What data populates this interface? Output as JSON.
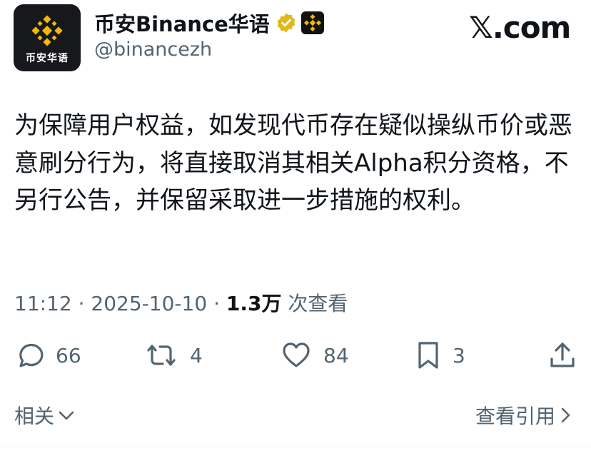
{
  "author": {
    "avatar_label": "币安华语",
    "display_name": "币安Binance华语",
    "handle": "@binancezh",
    "verified_icon": "verified-gold-badge-icon",
    "affiliate_icon": "binance-affiliate-badge-icon"
  },
  "site_logo": "𝕏.com",
  "tweet": {
    "text": "为保障用户权益，如发现代币存在疑似操纵币价或恶意刷分行为，将直接取消其相关Alpha积分资格，不另行公告，并保留采取进一步措施的权利。",
    "time": "11:12",
    "separator": "·",
    "date": "2025-10-10",
    "views": "1.3万",
    "views_label": "次查看"
  },
  "actions": {
    "replies": "66",
    "retweets": "4",
    "likes": "84",
    "bookmarks": "3"
  },
  "footer": {
    "related": "相关",
    "view_quotes": "查看引用"
  },
  "colors": {
    "binance_yellow": "#F0B90B",
    "text_primary": "#0f1419",
    "text_secondary": "#536471"
  }
}
